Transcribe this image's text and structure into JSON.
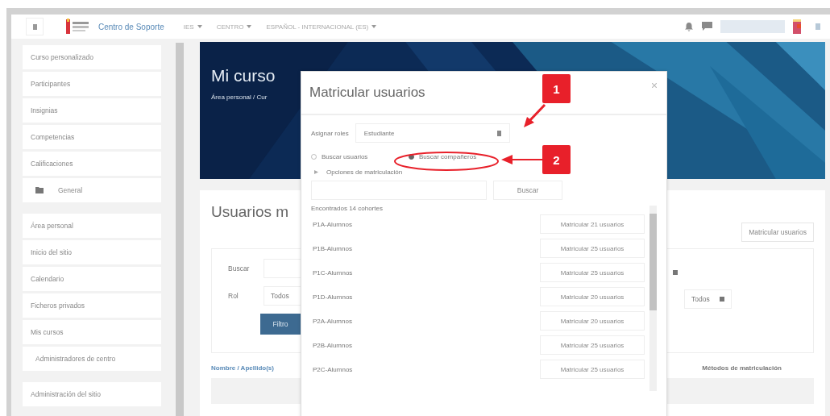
{
  "navbar": {
    "site_name": "Centro de Soporte",
    "menus": [
      "IES",
      "CENTRO",
      "ESPAÑOL - INTERNACIONAL (ES)"
    ]
  },
  "sidebar": {
    "groups": [
      {
        "items": [
          {
            "label": "Curso personalizado",
            "kind": "link"
          },
          {
            "label": "Participantes",
            "kind": "link"
          },
          {
            "label": "Insignias",
            "kind": "link"
          },
          {
            "label": "Competencias",
            "kind": "link"
          },
          {
            "label": "Calificaciones",
            "kind": "link"
          },
          {
            "label": "General",
            "kind": "folder"
          }
        ]
      },
      {
        "items": [
          {
            "label": "Área personal",
            "kind": "link"
          },
          {
            "label": "Inicio del sitio",
            "kind": "link"
          },
          {
            "label": "Calendario",
            "kind": "link"
          },
          {
            "label": "Ficheros privados",
            "kind": "link"
          },
          {
            "label": "Mis cursos",
            "kind": "link",
            "children": [
              {
                "label": "Administradores de centro"
              }
            ]
          }
        ]
      },
      {
        "items": [
          {
            "label": "Administración del sitio",
            "kind": "link"
          }
        ]
      }
    ]
  },
  "page_header": {
    "title": "Mi curso",
    "breadcrumb": "Área personal / Cur"
  },
  "card": {
    "title": "Usuarios m",
    "enrol_button": "Matricular usuarios",
    "search_label": "Buscar",
    "role_label": "Rol",
    "role_value": "Todos",
    "filter_button": "Filtro",
    "status_value": "Todos",
    "columns": [
      "Nombre / Apellido(s)",
      "Métodos de matriculación"
    ]
  },
  "modal": {
    "title": "Matricular usuarios",
    "role_label": "Asignar roles",
    "role_value": "Estudiante",
    "search_modes": [
      {
        "label": "Buscar usuarios",
        "selected": false
      },
      {
        "label": "Buscar compañeros",
        "selected": true
      }
    ],
    "options_toggle": "Opciones de matriculación",
    "search_button": "Buscar",
    "found": "Encontrados 14 cohortes",
    "cohorts": [
      {
        "name": "P1A-Alumnos",
        "action": "Matricular 21 usuarios"
      },
      {
        "name": "P1B-Alumnos",
        "action": "Matricular 25 usuarios"
      },
      {
        "name": "P1C-Alumnos",
        "action": "Matricular 25 usuarios"
      },
      {
        "name": "P1D-Alumnos",
        "action": "Matricular 20 usuarios"
      },
      {
        "name": "P2A-Alumnos",
        "action": "Matricular 20 usuarios"
      },
      {
        "name": "P2B-Alumnos",
        "action": "Matricular 25 usuarios"
      },
      {
        "name": "P2C-Alumnos",
        "action": "Matricular 25 usuarios"
      }
    ]
  },
  "callouts": [
    {
      "number": "1"
    },
    {
      "number": "2"
    }
  ]
}
